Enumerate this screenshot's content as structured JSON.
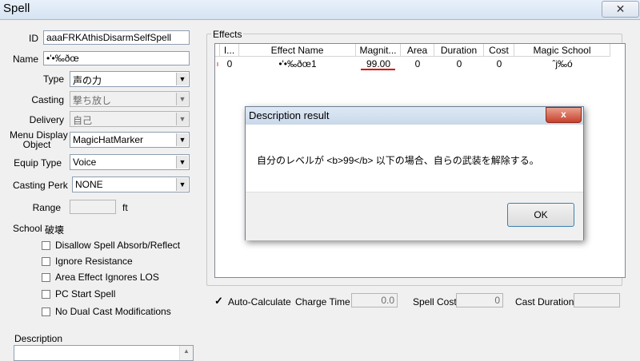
{
  "window": {
    "title": "Spell",
    "close_glyph": "✕"
  },
  "left": {
    "id_label": "ID",
    "id_value": "aaaFRKAthisDisarmSelfSpell",
    "name_label": "Name",
    "name_value": "•'•‰ðœ",
    "type_label": "Type",
    "type_value": "声の力",
    "casting_label": "Casting",
    "casting_value": "撃ち放し",
    "delivery_label": "Delivery",
    "delivery_value": "自己",
    "menu_display_label_1": "Menu Display",
    "menu_display_label_2": "Object",
    "menu_display_value": "MagicHatMarker",
    "equip_type_label": "Equip Type",
    "equip_type_value": "Voice",
    "casting_perk_label": "Casting Perk",
    "casting_perk_value": "NONE",
    "range_label": "Range",
    "range_unit": "ft",
    "school_label": "School",
    "school_value": "破壊",
    "checkboxes": [
      {
        "label": "Disallow Spell Absorb/Reflect"
      },
      {
        "label": "Ignore Resistance"
      },
      {
        "label": "Area Effect Ignores LOS"
      },
      {
        "label": "PC Start Spell"
      },
      {
        "label": "No Dual Cast Modifications"
      }
    ],
    "description_label": "Description"
  },
  "effects": {
    "group_label": "Effects",
    "columns": [
      "I...",
      "Effect Name",
      "Magnit...",
      "Area",
      "Duration",
      "Cost",
      "Magic School"
    ],
    "row": {
      "marker": "ı",
      "index": "0",
      "name": "•'•‰ðœ1",
      "magnitude": "99.00",
      "area": "0",
      "duration": "0",
      "cost": "0",
      "school": "ˆj‰ó"
    }
  },
  "bottom": {
    "auto_calc_label": "Auto-Calculate",
    "auto_calc_check": "✓",
    "charge_time_label": "Charge Time",
    "charge_time_value": "0.0",
    "spell_cost_label": "Spell Cost",
    "spell_cost_value": "0",
    "cast_duration_label": "Cast Duration",
    "cast_duration_value": ""
  },
  "dialog": {
    "title": "Description result",
    "close_glyph": "x",
    "message": "自分のレベルが <b>99</b> 以下の場合、自らの武装を解除する。",
    "ok_label": "OK"
  },
  "colors": {
    "accent_underline": "#d40000"
  }
}
